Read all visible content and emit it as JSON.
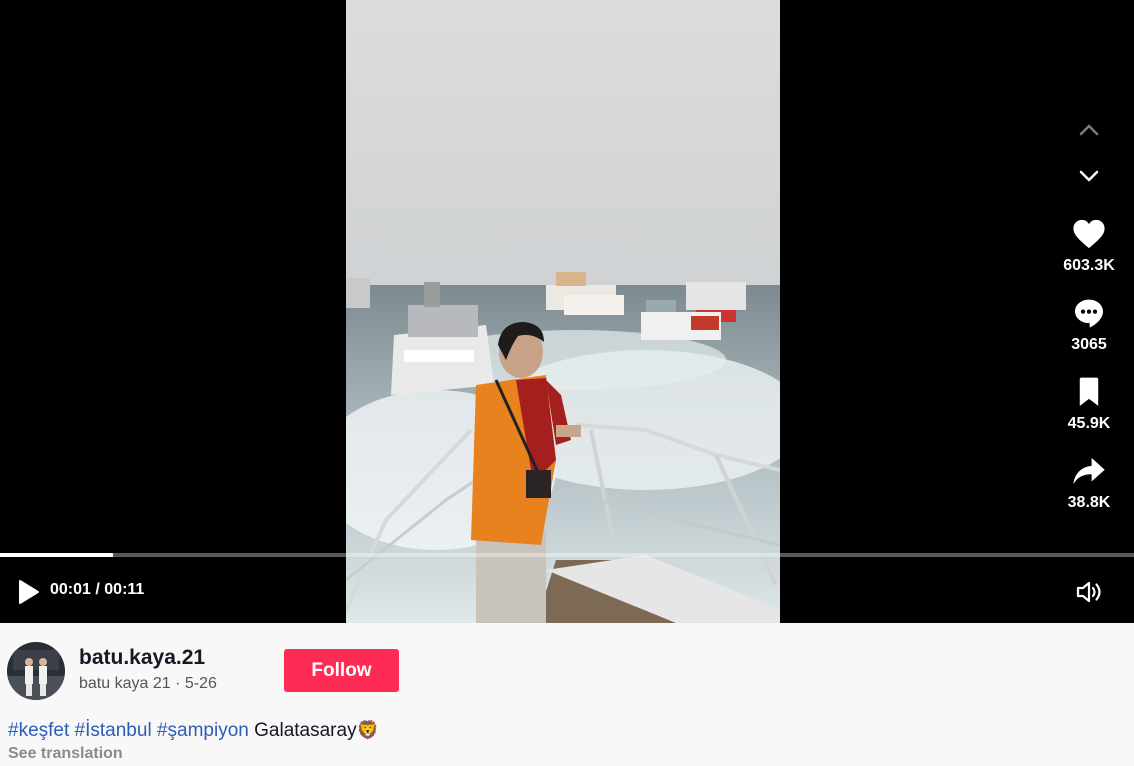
{
  "player": {
    "time_current": "00:01",
    "time_separator": " / ",
    "time_total": "00:11",
    "progress_fraction": 0.1
  },
  "actions": {
    "likes": "603.3K",
    "comments": "3065",
    "saves": "45.9K",
    "shares": "38.8K"
  },
  "author": {
    "username": "batu.kaya.21",
    "display_name": "batu kaya 21",
    "dot": " · ",
    "date": "5-26"
  },
  "follow": {
    "label": "Follow"
  },
  "caption": {
    "hashtags": [
      "#keşfet",
      "#İstanbul",
      "#şampiyon"
    ],
    "text": "Galatasaray",
    "emoji": "🦁"
  },
  "see_translation": "See translation",
  "icons": {
    "up": "chevron-up-icon",
    "down": "chevron-down-icon",
    "like": "heart-icon",
    "comment": "comment-bubble-icon",
    "save": "bookmark-icon",
    "share": "share-arrow-icon",
    "play": "play-icon",
    "volume": "volume-icon"
  },
  "colors": {
    "accent": "#fe2c55",
    "hashtag": "#2b5db9",
    "jersey_orange": "#e8821f",
    "jersey_red": "#a51f1f"
  }
}
